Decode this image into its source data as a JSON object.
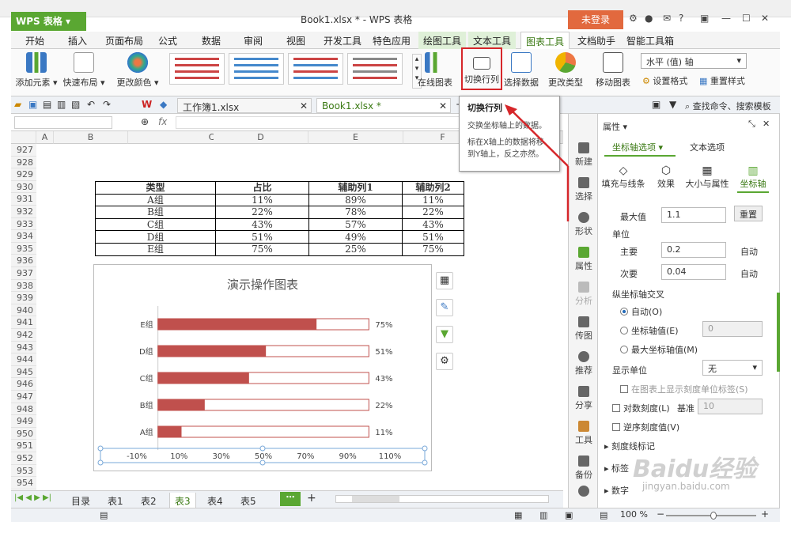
{
  "app": {
    "name": "WPS 表格",
    "title": "Book1.xlsx * - WPS 表格",
    "login": "未登录"
  },
  "menu": [
    "开始",
    "插入",
    "页面布局",
    "公式",
    "数据",
    "审阅",
    "视图",
    "开发工具",
    "特色应用",
    "绘图工具",
    "文本工具",
    "图表工具",
    "文档助手",
    "智能工具箱"
  ],
  "ribbon": {
    "add_element": "添加元素",
    "quick_layout": "快速布局",
    "change_color": "更改颜色",
    "online_chart": "在线图表",
    "switch_rowcol": "切换行列",
    "select_data": "选择数据",
    "change_type": "更改类型",
    "move_chart": "移动图表",
    "axis_select": "水平 (值) 轴",
    "set_format": "设置格式",
    "reset_style": "重置样式"
  },
  "doc_tabs": [
    "工作簿1.xlsx",
    "Book1.xlsx *"
  ],
  "search_placeholder": "查找命令、搜索模板",
  "formula": {
    "fx": "fx"
  },
  "columns": [
    "A",
    "B",
    "C",
    "D",
    "E",
    "F"
  ],
  "rows": [
    "927",
    "928",
    "929",
    "930",
    "931",
    "932",
    "933",
    "934",
    "935",
    "936",
    "937",
    "938",
    "939",
    "940",
    "941",
    "942",
    "943",
    "944",
    "945",
    "946",
    "947",
    "948",
    "949",
    "950",
    "951",
    "952",
    "953",
    "954"
  ],
  "table": {
    "headers": [
      "类型",
      "占比",
      "辅助列1",
      "辅助列2"
    ],
    "rows": [
      [
        "A组",
        "11%",
        "89%",
        "11%"
      ],
      [
        "B组",
        "22%",
        "78%",
        "22%"
      ],
      [
        "C组",
        "43%",
        "57%",
        "43%"
      ],
      [
        "D组",
        "51%",
        "49%",
        "51%"
      ],
      [
        "E组",
        "75%",
        "25%",
        "75%"
      ]
    ]
  },
  "chart_data": {
    "type": "bar",
    "title": "演示操作图表",
    "categories": [
      "E组",
      "D组",
      "C组",
      "B组",
      "A组"
    ],
    "series": [
      {
        "values": [
          75,
          51,
          43,
          22,
          11
        ],
        "color": "#c0504d"
      },
      {
        "values": [
          25,
          49,
          57,
          78,
          89
        ],
        "color": "#ffffff"
      }
    ],
    "data_labels": [
      "75%",
      "51%",
      "43%",
      "22%",
      "11%"
    ],
    "x_ticks": [
      "-10%",
      "10%",
      "30%",
      "50%",
      "70%",
      "90%",
      "110%"
    ],
    "xlim": [
      -10,
      110
    ],
    "stacked": true
  },
  "tooltip": {
    "title": "切换行列",
    "line1": "交换坐标轴上的数据。",
    "line2": "标在X轴上的数据将移到Y轴上，反之亦然。"
  },
  "sheets": [
    "目录",
    "表1",
    "表2",
    "表3",
    "表4",
    "表5"
  ],
  "active_sheet": "表3",
  "right_nav": [
    "新建",
    "选择",
    "形状",
    "属性",
    "分析",
    "传图",
    "推荐",
    "分享",
    "工具",
    "备份"
  ],
  "panel": {
    "title": "属性",
    "tabs": [
      "坐标轴选项",
      "文本选项"
    ],
    "subtabs": [
      "填充与线条",
      "效果",
      "大小与属性",
      "坐标轴"
    ],
    "max_label": "最大值",
    "max_value": "1.1",
    "reset": "重置",
    "unit": "单位",
    "major_label": "主要",
    "major_value": "0.2",
    "minor_label": "次要",
    "minor_value": "0.04",
    "auto": "自动",
    "cross_label": "纵坐标轴交叉",
    "cross_auto": "自动(O)",
    "cross_value": "坐标轴值(E)",
    "cross_value_input": "0",
    "cross_max": "最大坐标轴值(M)",
    "display_unit": "显示单位",
    "display_unit_value": "无",
    "show_unit_label": "在图表上显示刻度单位标签(S)",
    "log_scale": "对数刻度(L)",
    "base_label": "基准",
    "base_value": "10",
    "reverse": "逆序刻度值(V)",
    "tick_marks": "刻度线标记",
    "labels": "标签",
    "numbers": "数字"
  },
  "status": {
    "zoom": "100 %"
  },
  "watermark": {
    "text": "Baidu经验",
    "url": "jingyan.baidu.com"
  }
}
